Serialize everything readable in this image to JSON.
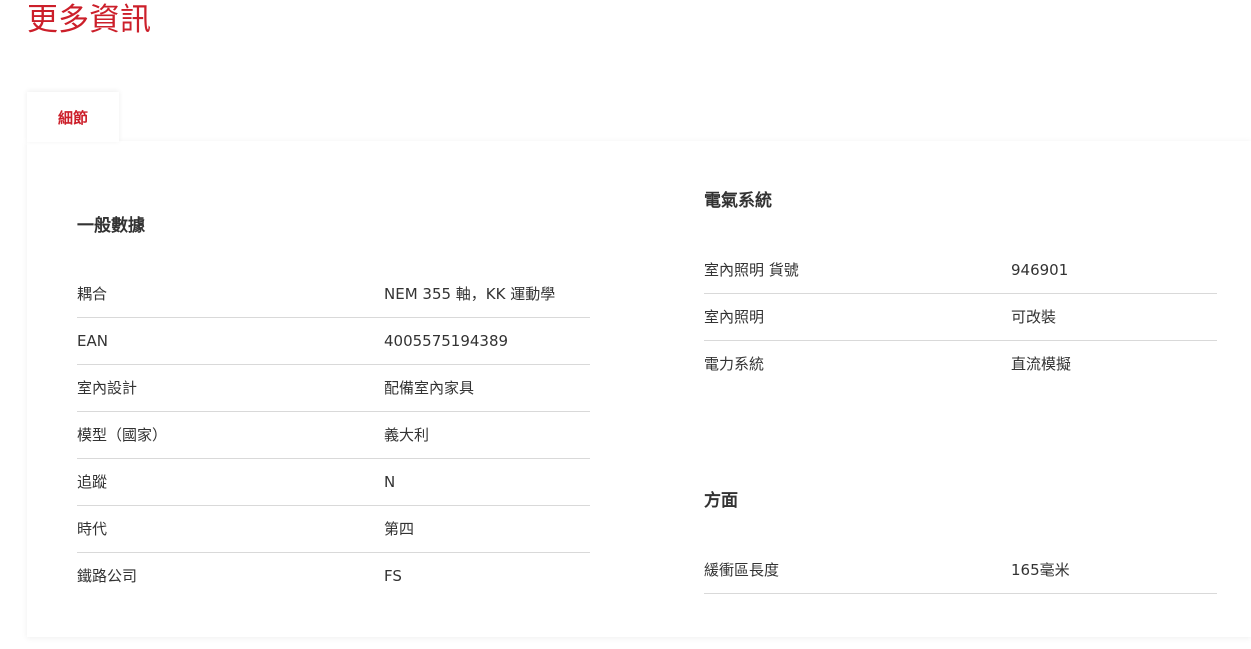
{
  "page_title": "更多資訊",
  "tabs": [
    {
      "label": "細節",
      "active": true
    }
  ],
  "general": {
    "heading": "一般數據",
    "rows": [
      {
        "label": "耦合",
        "value": "NEM 355 軸，KK 運動學"
      },
      {
        "label": "EAN",
        "value": "4005575194389"
      },
      {
        "label": "室內設計",
        "value": "配備室內家具"
      },
      {
        "label": "模型（國家）",
        "value": "義大利"
      },
      {
        "label": "追蹤",
        "value": "N"
      },
      {
        "label": "時代",
        "value": "第四"
      },
      {
        "label": "鐵路公司",
        "value": "FS"
      }
    ]
  },
  "electrical": {
    "heading": "電氣系統",
    "rows": [
      {
        "label": "室內照明 貨號",
        "value": "946901"
      },
      {
        "label": "室內照明",
        "value": "可改裝"
      },
      {
        "label": "電力系統",
        "value": "直流模擬"
      }
    ]
  },
  "dimensions": {
    "heading": "方面",
    "rows": [
      {
        "label": "緩衝區長度",
        "value": "165毫米"
      }
    ]
  },
  "colors": {
    "accent": "#cc1f2a",
    "text": "#333333",
    "divider": "#d9d9d9"
  }
}
